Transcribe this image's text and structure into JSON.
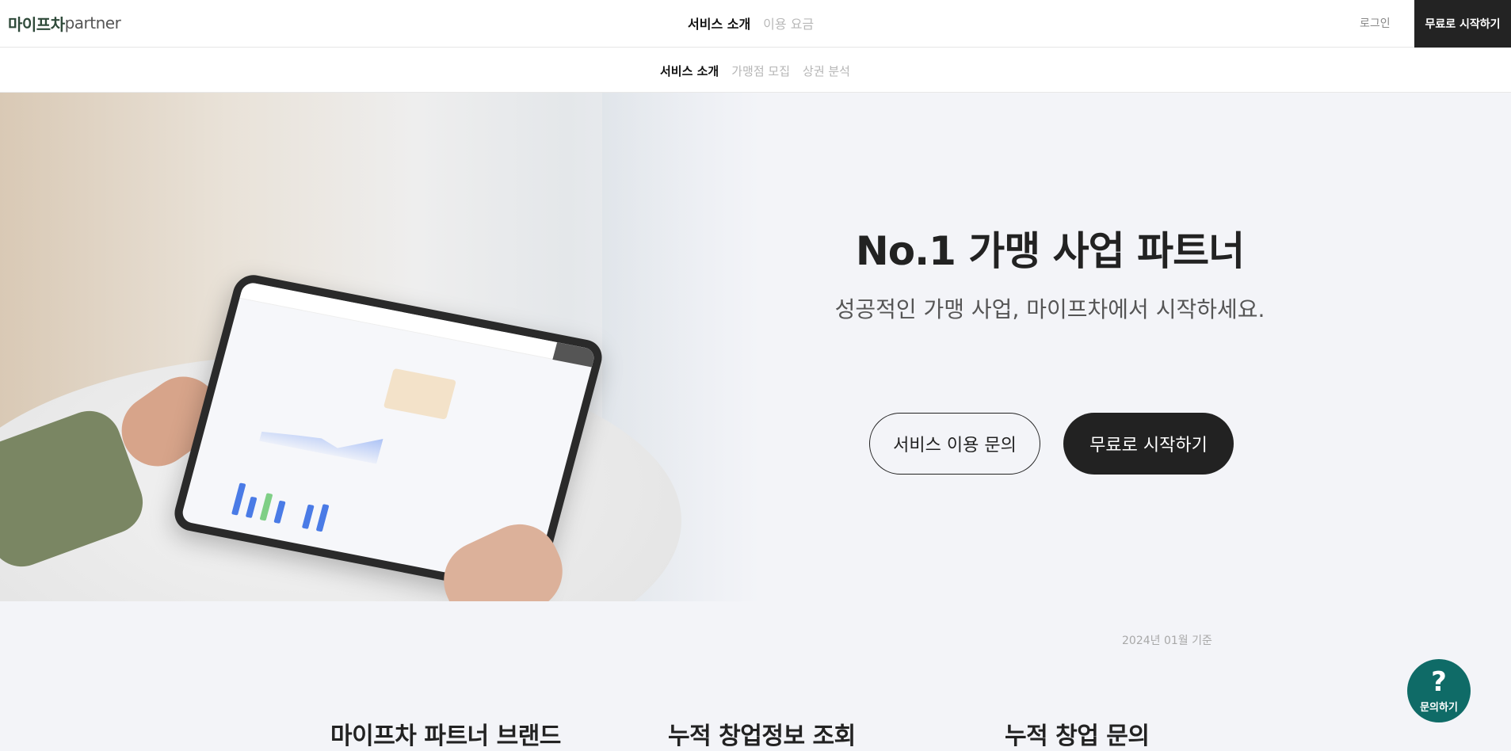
{
  "header": {
    "logo_brand": "마이프차",
    "logo_sub": "partner",
    "nav": [
      {
        "label": "서비스 소개",
        "active": true
      },
      {
        "label": "이용 요금",
        "active": false
      }
    ],
    "login_label": "로그인",
    "start_label": "무료로 시작하기"
  },
  "subnav": [
    {
      "label": "서비스 소개",
      "active": true
    },
    {
      "label": "가맹점 모집",
      "active": false
    },
    {
      "label": "상권 분석",
      "active": false
    }
  ],
  "hero": {
    "title": "No.1 가맹 사업 파트너",
    "subtitle": "성공적인 가맹 사업, 마이프차에서 시작하세요.",
    "inquiry_button": "서비스 이용 문의",
    "start_button": "무료로 시작하기"
  },
  "stats": {
    "as_of": "2024년 01월 기준",
    "items": [
      {
        "label": "마이프차 파트너 브랜드"
      },
      {
        "label": "누적 창업정보 조회"
      },
      {
        "label": "누적 창업 문의"
      }
    ]
  },
  "help": {
    "icon": "question-icon",
    "symbol": "?",
    "label": "문의하기",
    "color": "#0f6b67"
  }
}
